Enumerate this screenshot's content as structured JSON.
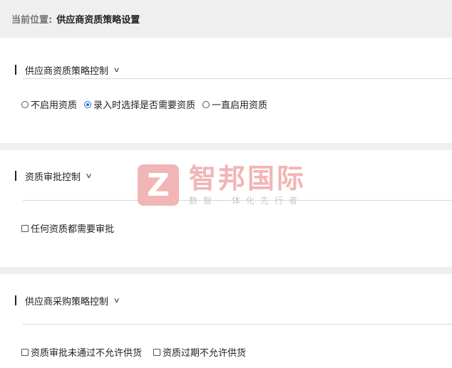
{
  "breadcrumb": {
    "prefix": "当前位置:",
    "current": "供应商资质策略设置"
  },
  "sections": [
    {
      "title": "供应商资质策略控制",
      "options": [
        {
          "type": "radio",
          "label": "不启用资质",
          "checked": false
        },
        {
          "type": "radio",
          "label": "录入时选择是否需要资质",
          "checked": true
        },
        {
          "type": "radio",
          "label": "一直启用资质",
          "checked": false
        }
      ]
    },
    {
      "title": "资质审批控制",
      "options": [
        {
          "type": "checkbox",
          "label": "任何资质都需要审批",
          "checked": false
        }
      ]
    },
    {
      "title": "供应商采购策略控制",
      "options": [
        {
          "type": "checkbox",
          "label": "资质审批未通过不允许供货",
          "checked": false
        },
        {
          "type": "checkbox",
          "label": "资质过期不允许供货",
          "checked": false
        }
      ]
    }
  ],
  "watermark": {
    "logo_letter": "Z",
    "brand": "智邦国际",
    "slogan": "数智一体化先行者"
  },
  "icons": {
    "collapse": "chevron-down-icon"
  },
  "colors": {
    "accent": "#1f6fd1",
    "watermark": "#f1b5b5",
    "band": "#efefef"
  }
}
